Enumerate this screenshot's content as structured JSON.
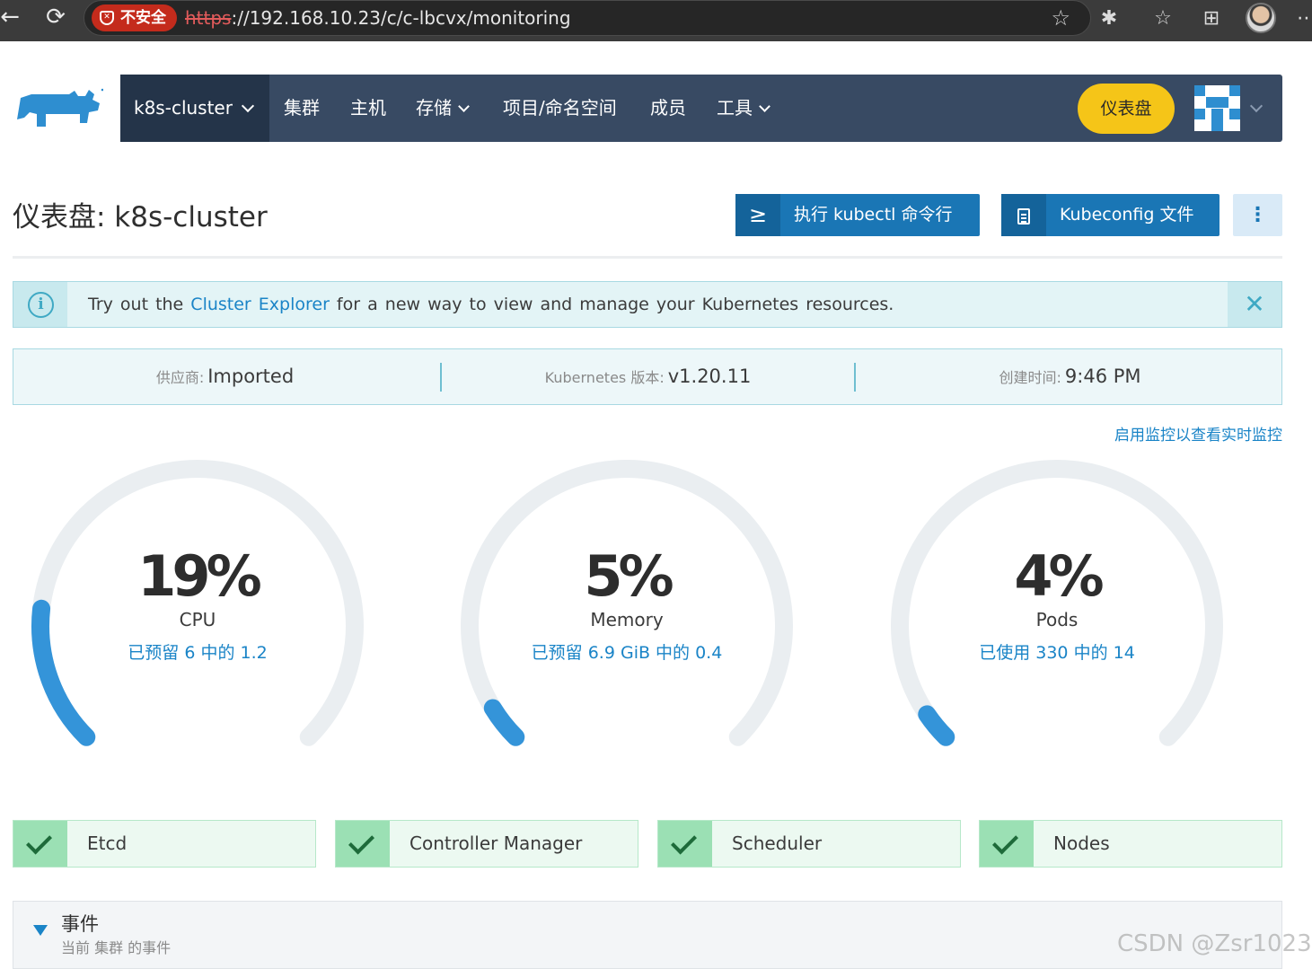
{
  "browser": {
    "security_label": "不安全",
    "url_protocol": "https",
    "url_rest": "://192.168.10.23/c/c-lbcvx/monitoring"
  },
  "nav": {
    "cluster": "k8s-cluster",
    "items": [
      "集群",
      "主机",
      "存储",
      "项目/命名空间",
      "成员",
      "工具"
    ],
    "dashboard_button": "仪表盘"
  },
  "header": {
    "title": "仪表盘: k8s-cluster",
    "kubectl_button": "执行 kubectl 命令行",
    "kubeconfig_button": "Kubeconfig 文件"
  },
  "banner": {
    "text_before": "Try out the ",
    "link": "Cluster Explorer",
    "text_after": " for a new way to view and manage your Kubernetes resources."
  },
  "info": {
    "provider_label": "供应商:",
    "provider_value": "Imported",
    "k8s_label": "Kubernetes 版本:",
    "k8s_value": "v1.20.11",
    "created_label": "创建时间:",
    "created_value": "9:46 PM"
  },
  "monitoring_link": "启用监控以查看实时监控",
  "gauges": [
    {
      "percent": 19,
      "value_text": "19%",
      "title": "CPU",
      "detail": "已预留 6 中的 1.2"
    },
    {
      "percent": 5,
      "value_text": "5%",
      "title": "Memory",
      "detail": "已预留 6.9 GiB 中的 0.4"
    },
    {
      "percent": 4,
      "value_text": "4%",
      "title": "Pods",
      "detail": "已使用 330 中的 14"
    }
  ],
  "components": [
    "Etcd",
    "Controller Manager",
    "Scheduler",
    "Nodes"
  ],
  "events": {
    "title": "事件",
    "subtitle": "当前 集群 的事件"
  },
  "watermark": "CSDN @Zsr1023",
  "colors": {
    "nav_bg": "#384a63",
    "cluster_bg": "#243449",
    "accent_blue": "#1a76b5",
    "gauge_fill": "#3494d9",
    "gauge_track": "#eaeef1",
    "success": "#9be0b4",
    "dashboard_yellow": "#f5c518"
  }
}
